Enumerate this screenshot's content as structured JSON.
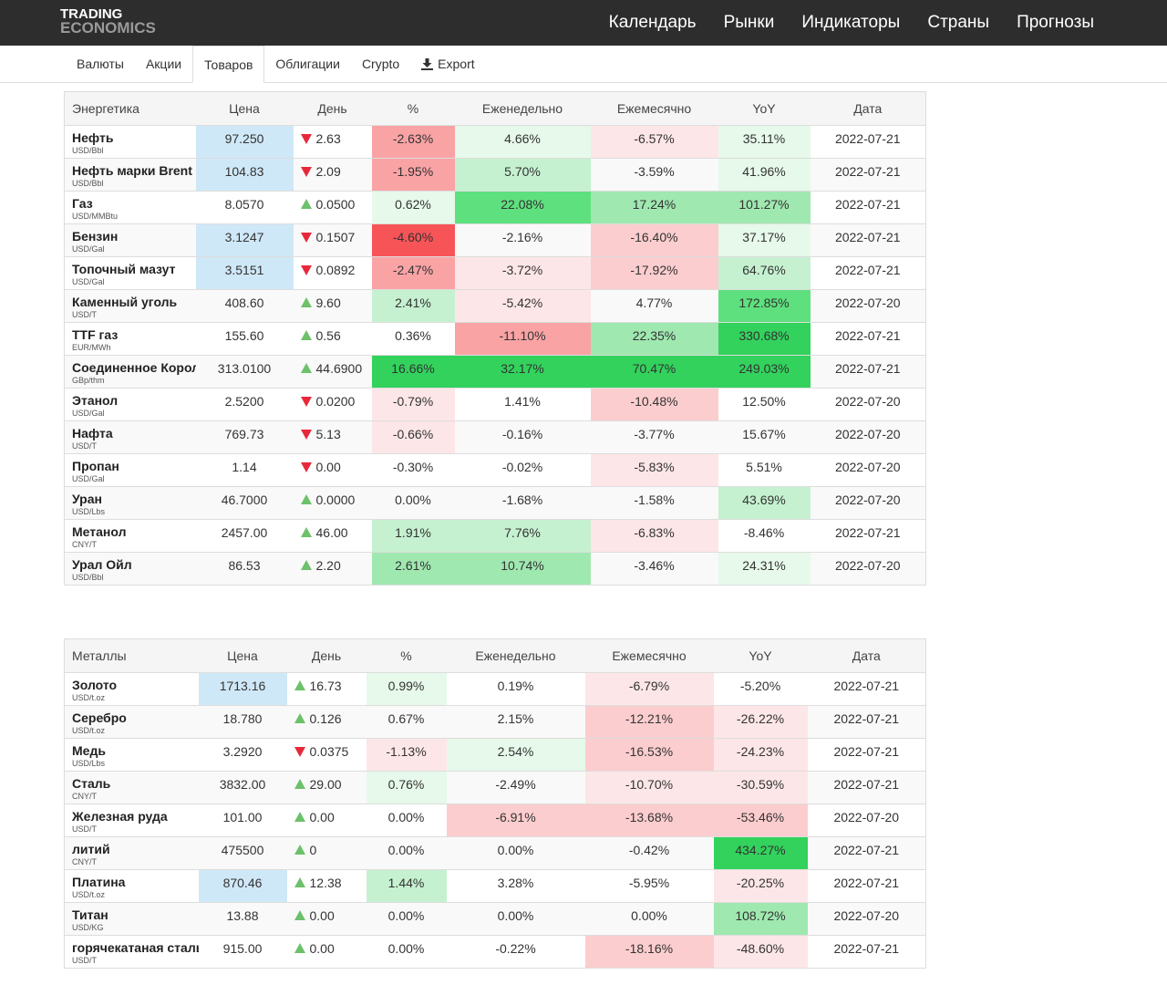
{
  "logo": {
    "line1": "TRADING",
    "line2": "ECONOMICS"
  },
  "nav": [
    "Календарь",
    "Рынки",
    "Индикаторы",
    "Страны",
    "Прогнозы"
  ],
  "tabs": [
    {
      "label": "Валюты",
      "active": false
    },
    {
      "label": "Акции",
      "active": false
    },
    {
      "label": "Товаров",
      "active": true
    },
    {
      "label": "Облигации",
      "active": false
    },
    {
      "label": "Crypto",
      "active": false
    },
    {
      "label": "Export",
      "active": false,
      "icon": "download-icon"
    }
  ],
  "colors": {
    "price_highlight": "#cfe8f7",
    "red_strong": "#f75458",
    "red_medium": "#f9a3a5",
    "red_light": "#fccdce",
    "red_faint": "#fde6e7",
    "green_strong": "#32d25c",
    "green_medium": "#5ee07e",
    "green_soft": "#9fe8b0",
    "green_light": "#c5f1d0",
    "green_faint": "#e6f9ea"
  },
  "tables": [
    {
      "title": "Энергетика",
      "headers": [
        "Цена",
        "День",
        "%",
        "Еженедельно",
        "Ежемесячно",
        "YoY",
        "Дата"
      ],
      "rows": [
        {
          "name": "Нефть",
          "unit": "USD/Bbl",
          "price": "97.250",
          "ph": true,
          "dir": "down",
          "day": "2.63",
          "pct": "-2.63%",
          "pc": "red_medium",
          "week": "4.66%",
          "wc": "green_faint",
          "month": "-6.57%",
          "mc": "red_faint",
          "yoy": "35.11%",
          "yc": "green_faint",
          "date": "2022-07-21"
        },
        {
          "name": "Нефть марки Brent",
          "unit": "USD/Bbl",
          "price": "104.83",
          "ph": true,
          "dir": "down",
          "day": "2.09",
          "pct": "-1.95%",
          "pc": "red_medium",
          "week": "5.70%",
          "wc": "green_light",
          "month": "-3.59%",
          "mc": "",
          "yoy": "41.96%",
          "yc": "green_faint",
          "date": "2022-07-21"
        },
        {
          "name": "Газ",
          "unit": "USD/MMBtu",
          "price": "8.0570",
          "ph": false,
          "dir": "up",
          "day": "0.0500",
          "pct": "0.62%",
          "pc": "green_faint",
          "week": "22.08%",
          "wc": "green_medium",
          "month": "17.24%",
          "mc": "green_soft",
          "yoy": "101.27%",
          "yc": "green_soft",
          "date": "2022-07-21"
        },
        {
          "name": "Бензин",
          "unit": "USD/Gal",
          "price": "3.1247",
          "ph": true,
          "dir": "down",
          "day": "0.1507",
          "pct": "-4.60%",
          "pc": "red_strong",
          "week": "-2.16%",
          "wc": "",
          "month": "-16.40%",
          "mc": "red_light",
          "yoy": "37.17%",
          "yc": "green_faint",
          "date": "2022-07-21"
        },
        {
          "name": "Топочный мазут",
          "unit": "USD/Gal",
          "price": "3.5151",
          "ph": true,
          "dir": "down",
          "day": "0.0892",
          "pct": "-2.47%",
          "pc": "red_medium",
          "week": "-3.72%",
          "wc": "red_faint",
          "month": "-17.92%",
          "mc": "red_light",
          "yoy": "64.76%",
          "yc": "green_light",
          "date": "2022-07-21"
        },
        {
          "name": "Каменный уголь",
          "unit": "USD/T",
          "price": "408.60",
          "ph": false,
          "dir": "up",
          "day": "9.60",
          "pct": "2.41%",
          "pc": "green_light",
          "week": "-5.42%",
          "wc": "red_faint",
          "month": "4.77%",
          "mc": "",
          "yoy": "172.85%",
          "yc": "green_medium",
          "date": "2022-07-20"
        },
        {
          "name": "TTF газ",
          "unit": "EUR/MWh",
          "price": "155.60",
          "ph": false,
          "dir": "up",
          "day": "0.56",
          "pct": "0.36%",
          "pc": "",
          "week": "-11.10%",
          "wc": "red_medium",
          "month": "22.35%",
          "mc": "green_soft",
          "yoy": "330.68%",
          "yc": "green_strong",
          "date": "2022-07-21"
        },
        {
          "name": "Соединенное Королевство Газ",
          "unit": "GBp/thm",
          "price": "313.0100",
          "ph": false,
          "dir": "up",
          "day": "44.6900",
          "pct": "16.66%",
          "pc": "green_strong",
          "week": "32.17%",
          "wc": "green_strong",
          "month": "70.47%",
          "mc": "green_strong",
          "yoy": "249.03%",
          "yc": "green_strong",
          "date": "2022-07-21"
        },
        {
          "name": "Этанол",
          "unit": "USD/Gal",
          "price": "2.5200",
          "ph": false,
          "dir": "down",
          "day": "0.0200",
          "pct": "-0.79%",
          "pc": "red_faint",
          "week": "1.41%",
          "wc": "",
          "month": "-10.48%",
          "mc": "red_light",
          "yoy": "12.50%",
          "yc": "",
          "date": "2022-07-20"
        },
        {
          "name": "Нафта",
          "unit": "USD/T",
          "price": "769.73",
          "ph": false,
          "dir": "down",
          "day": "5.13",
          "pct": "-0.66%",
          "pc": "red_faint",
          "week": "-0.16%",
          "wc": "",
          "month": "-3.77%",
          "mc": "",
          "yoy": "15.67%",
          "yc": "",
          "date": "2022-07-20"
        },
        {
          "name": "Пропан",
          "unit": "USD/Gal",
          "price": "1.14",
          "ph": false,
          "dir": "down",
          "day": "0.00",
          "pct": "-0.30%",
          "pc": "",
          "week": "-0.02%",
          "wc": "",
          "month": "-5.83%",
          "mc": "red_faint",
          "yoy": "5.51%",
          "yc": "",
          "date": "2022-07-20"
        },
        {
          "name": "Уран",
          "unit": "USD/Lbs",
          "price": "46.7000",
          "ph": false,
          "dir": "up",
          "day": "0.0000",
          "pct": "0.00%",
          "pc": "",
          "week": "-1.68%",
          "wc": "",
          "month": "-1.58%",
          "mc": "",
          "yoy": "43.69%",
          "yc": "green_light",
          "date": "2022-07-20"
        },
        {
          "name": "Метанол",
          "unit": "CNY/T",
          "price": "2457.00",
          "ph": false,
          "dir": "up",
          "day": "46.00",
          "pct": "1.91%",
          "pc": "green_light",
          "week": "7.76%",
          "wc": "green_light",
          "month": "-6.83%",
          "mc": "red_faint",
          "yoy": "-8.46%",
          "yc": "",
          "date": "2022-07-21"
        },
        {
          "name": "Урал Ойл",
          "unit": "USD/Bbl",
          "price": "86.53",
          "ph": false,
          "dir": "up",
          "day": "2.20",
          "pct": "2.61%",
          "pc": "green_soft",
          "week": "10.74%",
          "wc": "green_soft",
          "month": "-3.46%",
          "mc": "",
          "yoy": "24.31%",
          "yc": "green_faint",
          "date": "2022-07-20"
        }
      ]
    },
    {
      "title": "Металлы",
      "headers": [
        "Цена",
        "День",
        "%",
        "Еженедельно",
        "Ежемесячно",
        "YoY",
        "Дата"
      ],
      "rows": [
        {
          "name": "Золото",
          "unit": "USD/t.oz",
          "price": "1713.16",
          "ph": true,
          "dir": "up",
          "day": "16.73",
          "pct": "0.99%",
          "pc": "green_faint",
          "week": "0.19%",
          "wc": "",
          "month": "-6.79%",
          "mc": "red_faint",
          "yoy": "-5.20%",
          "yc": "",
          "date": "2022-07-21"
        },
        {
          "name": "Серебро",
          "unit": "USD/t.oz",
          "price": "18.780",
          "ph": false,
          "dir": "up",
          "day": "0.126",
          "pct": "0.67%",
          "pc": "",
          "week": "2.15%",
          "wc": "",
          "month": "-12.21%",
          "mc": "red_light",
          "yoy": "-26.22%",
          "yc": "red_faint",
          "date": "2022-07-21"
        },
        {
          "name": "Медь",
          "unit": "USD/Lbs",
          "price": "3.2920",
          "ph": false,
          "dir": "down",
          "day": "0.0375",
          "pct": "-1.13%",
          "pc": "red_faint",
          "week": "2.54%",
          "wc": "green_faint",
          "month": "-16.53%",
          "mc": "red_light",
          "yoy": "-24.23%",
          "yc": "red_faint",
          "date": "2022-07-21"
        },
        {
          "name": "Сталь",
          "unit": "CNY/T",
          "price": "3832.00",
          "ph": false,
          "dir": "up",
          "day": "29.00",
          "pct": "0.76%",
          "pc": "green_faint",
          "week": "-2.49%",
          "wc": "",
          "month": "-10.70%",
          "mc": "red_faint",
          "yoy": "-30.59%",
          "yc": "red_faint",
          "date": "2022-07-21"
        },
        {
          "name": "Железная руда",
          "unit": "USD/T",
          "price": "101.00",
          "ph": false,
          "dir": "up",
          "day": "0.00",
          "pct": "0.00%",
          "pc": "",
          "week": "-6.91%",
          "wc": "red_light",
          "month": "-13.68%",
          "mc": "red_light",
          "yoy": "-53.46%",
          "yc": "red_light",
          "date": "2022-07-20"
        },
        {
          "name": "литий",
          "unit": "CNY/T",
          "price": "475500",
          "ph": false,
          "dir": "up",
          "day": "0",
          "pct": "0.00%",
          "pc": "",
          "week": "0.00%",
          "wc": "",
          "month": "-0.42%",
          "mc": "",
          "yoy": "434.27%",
          "yc": "green_strong",
          "date": "2022-07-21"
        },
        {
          "name": "Платина",
          "unit": "USD/t.oz",
          "price": "870.46",
          "ph": true,
          "dir": "up",
          "day": "12.38",
          "pct": "1.44%",
          "pc": "green_light",
          "week": "3.28%",
          "wc": "",
          "month": "-5.95%",
          "mc": "",
          "yoy": "-20.25%",
          "yc": "red_faint",
          "date": "2022-07-21"
        },
        {
          "name": "Титан",
          "unit": "USD/KG",
          "price": "13.88",
          "ph": false,
          "dir": "up",
          "day": "0.00",
          "pct": "0.00%",
          "pc": "",
          "week": "0.00%",
          "wc": "",
          "month": "0.00%",
          "mc": "",
          "yoy": "108.72%",
          "yc": "green_soft",
          "date": "2022-07-20"
        },
        {
          "name": "горячекатаная сталь",
          "unit": "USD/T",
          "price": "915.00",
          "ph": false,
          "dir": "up",
          "day": "0.00",
          "pct": "0.00%",
          "pc": "",
          "week": "-0.22%",
          "wc": "",
          "month": "-18.16%",
          "mc": "red_light",
          "yoy": "-48.60%",
          "yc": "red_faint",
          "date": "2022-07-21"
        }
      ]
    }
  ]
}
